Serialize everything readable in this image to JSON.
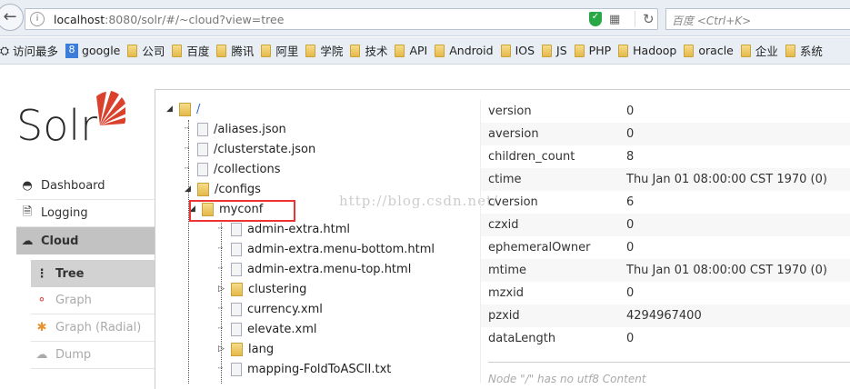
{
  "browser": {
    "url_host": "localhost",
    "url_rest": ":8080/solr/#/~cloud?view=tree",
    "search_placeholder": "百度 <Ctrl+K>"
  },
  "bookmarks": [
    "访问最多",
    "google",
    "公司",
    "百度",
    "腾讯",
    "阿里",
    "学院",
    "技术",
    "API",
    "Android",
    "IOS",
    "JS",
    "PHP",
    "Hadoop",
    "oracle",
    "企业",
    "系统"
  ],
  "logo": {
    "text": "Solr"
  },
  "sidebar": {
    "items": [
      {
        "label": "Dashboard"
      },
      {
        "label": "Logging"
      },
      {
        "label": "Cloud"
      }
    ],
    "cloud_sub": [
      {
        "label": "Tree"
      },
      {
        "label": "Graph"
      },
      {
        "label": "Graph (Radial)"
      },
      {
        "label": "Dump"
      }
    ]
  },
  "tree": {
    "nodes": [
      {
        "label": "/",
        "type": "folder"
      },
      {
        "label": "/aliases.json",
        "type": "file"
      },
      {
        "label": "/clusterstate.json",
        "type": "file"
      },
      {
        "label": "/collections",
        "type": "file"
      },
      {
        "label": "/configs",
        "type": "folder"
      },
      {
        "label": "myconf",
        "type": "folder"
      },
      {
        "label": "admin-extra.html",
        "type": "file"
      },
      {
        "label": "admin-extra.menu-bottom.html",
        "type": "file"
      },
      {
        "label": "admin-extra.menu-top.html",
        "type": "file"
      },
      {
        "label": "clustering",
        "type": "folder"
      },
      {
        "label": "currency.xml",
        "type": "file"
      },
      {
        "label": "elevate.xml",
        "type": "file"
      },
      {
        "label": "lang",
        "type": "folder"
      },
      {
        "label": "mapping-FoldToASCII.txt",
        "type": "file"
      }
    ]
  },
  "details": {
    "rows": [
      {
        "key": "version",
        "value": "0"
      },
      {
        "key": "aversion",
        "value": "0"
      },
      {
        "key": "children_count",
        "value": "8"
      },
      {
        "key": "ctime",
        "value": "Thu Jan 01 08:00:00 CST 1970 (0)"
      },
      {
        "key": "cversion",
        "value": "6"
      },
      {
        "key": "czxid",
        "value": "0"
      },
      {
        "key": "ephemeralOwner",
        "value": "0"
      },
      {
        "key": "mtime",
        "value": "Thu Jan 01 08:00:00 CST 1970 (0)"
      },
      {
        "key": "mzxid",
        "value": "0"
      },
      {
        "key": "pzxid",
        "value": "4294967400"
      },
      {
        "key": "dataLength",
        "value": "0"
      }
    ],
    "no_content": "Node \"/\" has no utf8 Content"
  },
  "watermark": "http://blog.csdn.net/"
}
